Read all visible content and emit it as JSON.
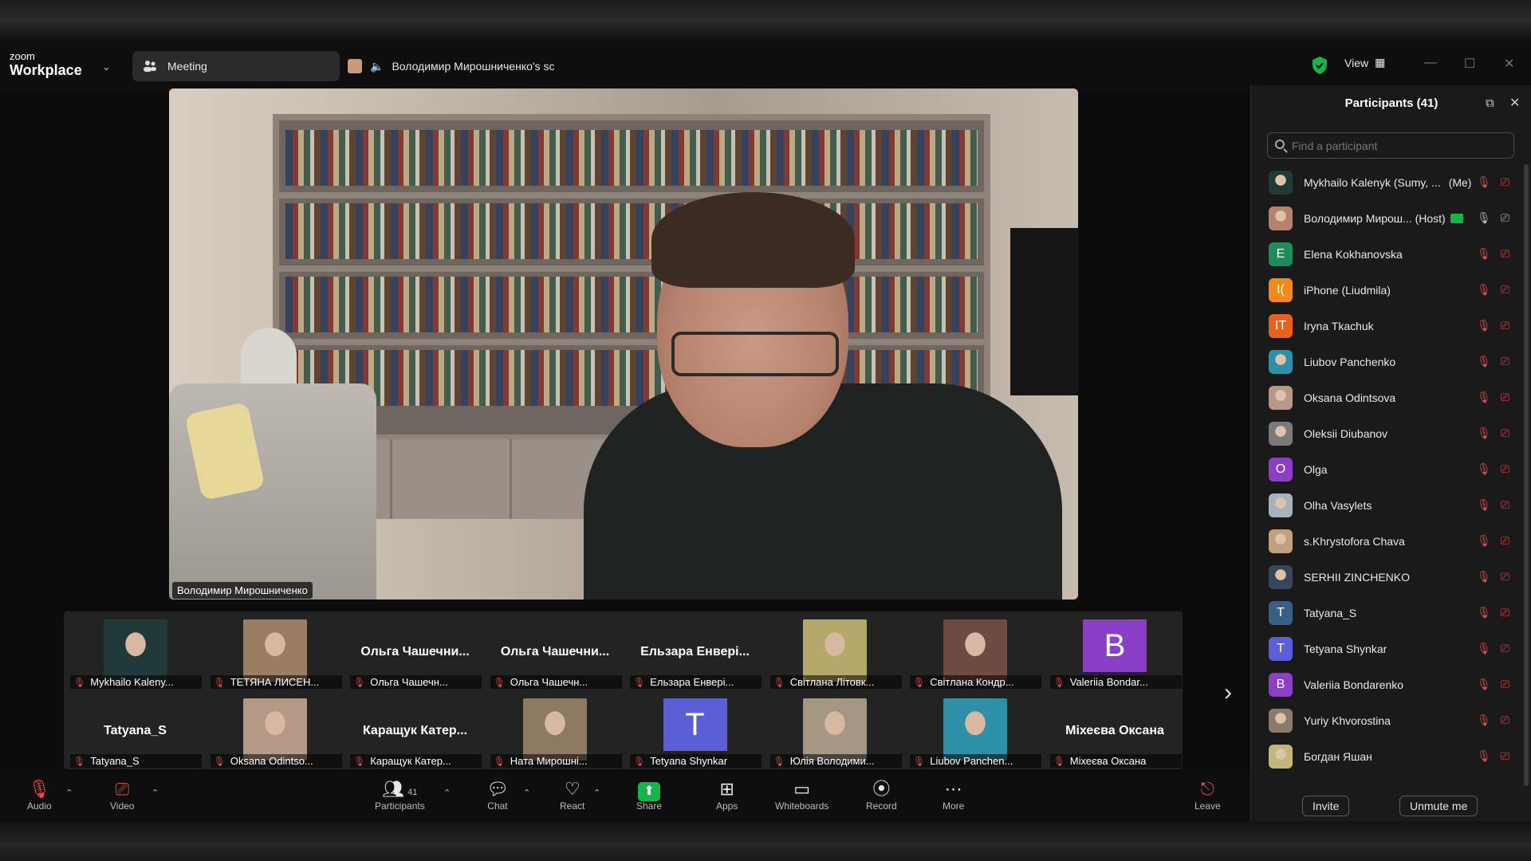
{
  "app": {
    "logo_small": "zoom",
    "logo_big": "Workplace",
    "meeting_tab": "Meeting",
    "share_tab": "Володимир Мирошниченко's sc",
    "view_label": "View"
  },
  "main_video": {
    "name": "Володимир Мирошниченко"
  },
  "gallery": {
    "tiles": [
      {
        "type": "photo",
        "caption": "Mykhailo Kaleny...",
        "color": "#1f3a38"
      },
      {
        "type": "photo",
        "caption": "ТЕТЯНА ЛИСЕН...",
        "color": "#9a7d63"
      },
      {
        "type": "name",
        "big": "Ольга  Чашечни...",
        "caption": "Ольга Чашечн..."
      },
      {
        "type": "name",
        "big": "Ольга  Чашечни...",
        "caption": "Ольга Чашечн..."
      },
      {
        "type": "name",
        "big": "Ельзара  Енвері...",
        "caption": "Ельзара Енвері..."
      },
      {
        "type": "photo",
        "caption": "Світлана Літовк...",
        "color": "#b4a86a"
      },
      {
        "type": "photo",
        "caption": "Світлана Кондр...",
        "color": "#6d4a42"
      },
      {
        "type": "letter",
        "letter": "B",
        "caption": "Valeriia Bondar...",
        "color": "#8b3fc7"
      },
      {
        "type": "name",
        "big": "Tatyana_S",
        "caption": "Tatyana_S"
      },
      {
        "type": "photo",
        "caption": "Oksana Odintso...",
        "color": "#b49a86"
      },
      {
        "type": "name",
        "big": "Каращук  Катер...",
        "caption": "Каращук Катер..."
      },
      {
        "type": "photo",
        "caption": "Ната Мирошні...",
        "color": "#8d7a63"
      },
      {
        "type": "letter",
        "letter": "T",
        "caption": "Tetyana Shynkar",
        "color": "#5a5fd6"
      },
      {
        "type": "photo",
        "caption": "Юлія Володими...",
        "color": "#a69684"
      },
      {
        "type": "photo",
        "caption": "Liubov Panchen...",
        "color": "#2e8fa8"
      },
      {
        "type": "name",
        "big": "Міхеєва Оксана",
        "caption": "Міхеєва Оксана"
      }
    ]
  },
  "panel": {
    "title": "Participants (41)",
    "search_placeholder": "Find a participant",
    "invite_label": "Invite",
    "unmute_label": "Unmute me",
    "participants": [
      {
        "name": "Mykhailo Kalenyk (Sumy, ...",
        "tag": "(Me)",
        "avatar_type": "photo",
        "color": "#1f3a38"
      },
      {
        "name": "Володимир Мирош... (Host)",
        "tag": "",
        "avatar_type": "photo",
        "color": "#b6826d",
        "host": true
      },
      {
        "name": "Elena Kokhanovska",
        "avatar_type": "letter",
        "letter": "E",
        "color": "#1f8a5a"
      },
      {
        "name": "iPhone (Liudmila)",
        "avatar_type": "letter",
        "letter": "I(",
        "color": "#f08a1c"
      },
      {
        "name": "Iryna Tkachuk",
        "avatar_type": "letter",
        "letter": "IT",
        "color": "#e8601c"
      },
      {
        "name": "Liubov Panchenko",
        "avatar_type": "photo",
        "color": "#2e8fa8"
      },
      {
        "name": "Oksana Odintsova",
        "avatar_type": "photo",
        "color": "#b49a86"
      },
      {
        "name": "Oleksii Diubanov",
        "avatar_type": "photo",
        "color": "#7a7a7a"
      },
      {
        "name": "Olga",
        "avatar_type": "letter",
        "letter": "O",
        "color": "#8b3fc7"
      },
      {
        "name": "Olha Vasylets",
        "avatar_type": "photo",
        "color": "#a7b2bd"
      },
      {
        "name": "s.Khrystofora Chava",
        "avatar_type": "photo",
        "color": "#c2a07f"
      },
      {
        "name": "SERHII ZINCHENKO",
        "avatar_type": "photo",
        "color": "#37465a"
      },
      {
        "name": "Tatyana_S",
        "avatar_type": "letter",
        "letter": "T",
        "color": "#3a5f86"
      },
      {
        "name": "Tetyana Shynkar",
        "avatar_type": "letter",
        "letter": "T",
        "color": "#5a5fd6"
      },
      {
        "name": "Valeriia Bondarenko",
        "avatar_type": "letter",
        "letter": "B",
        "color": "#8b3fc7"
      },
      {
        "name": "Yuriy Khvorostina",
        "avatar_type": "photo",
        "color": "#8a7a6a"
      },
      {
        "name": "Богдан Яшан",
        "avatar_type": "photo",
        "color": "#c4b57a"
      }
    ]
  },
  "toolbar": {
    "audio": "Audio",
    "video": "Video",
    "participants": "Participants",
    "participants_count": "41",
    "chat": "Chat",
    "react": "React",
    "share": "Share",
    "apps": "Apps",
    "whiteboards": "Whiteboards",
    "record": "Record",
    "more": "More",
    "leave": "Leave"
  },
  "colors": {
    "accent_green": "#19b34b",
    "mute_red": "#e24b4b",
    "panel_bg": "#1a1a1a"
  }
}
